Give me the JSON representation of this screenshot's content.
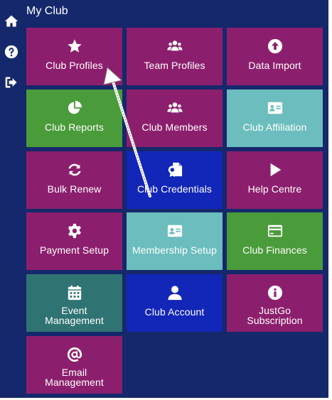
{
  "header": {
    "title": "My Club"
  },
  "colors": {
    "background": "#15286b",
    "purple": "#8c1f6d",
    "green": "#4a9b3a",
    "teal": "#6cbdbd",
    "blue": "#1226b8",
    "darkteal": "#2f7472"
  },
  "tiles": [
    {
      "label": "Club Profiles",
      "icon": "star-icon"
    },
    {
      "label": "Team Profiles",
      "icon": "users-icon"
    },
    {
      "label": "Data Import",
      "icon": "upload-circle-icon"
    },
    {
      "label": "Club Reports",
      "icon": "pie-chart-icon"
    },
    {
      "label": "Club Members",
      "icon": "users-icon"
    },
    {
      "label": "Club Affiliation",
      "icon": "id-card-icon"
    },
    {
      "label": "Bulk Renew",
      "icon": "sync-icon"
    },
    {
      "label": "Club Credentials",
      "icon": "certificate-file-icon"
    },
    {
      "label": "Help Centre",
      "icon": "play-icon"
    },
    {
      "label": "Payment Setup",
      "icon": "gear-icon"
    },
    {
      "label": "Membership Setup",
      "icon": "id-card-icon"
    },
    {
      "label": "Club Finances",
      "icon": "credit-card-icon"
    },
    {
      "label": "Event\nManagement",
      "icon": "calendar-icon"
    },
    {
      "label": "Club Account",
      "icon": "user-icon"
    },
    {
      "label": "JustGo\nSubscription",
      "icon": "info-circle-icon"
    },
    {
      "label": "Email\nManagement",
      "icon": "at-icon"
    }
  ]
}
